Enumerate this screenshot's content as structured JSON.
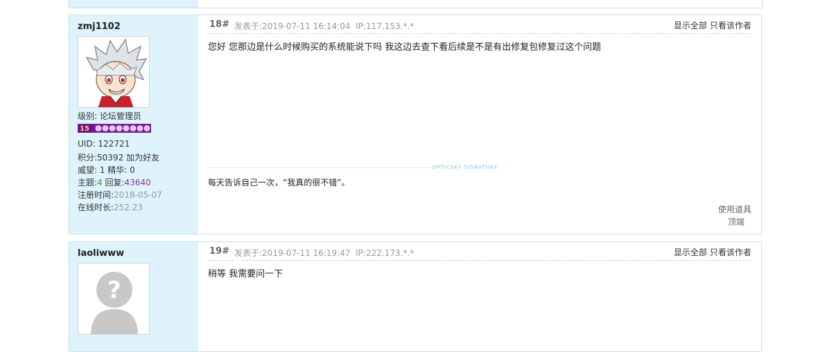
{
  "posts": [
    {
      "username": "zmj1102",
      "level_label": "级别: 论坛管理员",
      "level_badge": "15",
      "uid": "UID: 122721",
      "points_label": "积分:",
      "points": "50392",
      "add_friend": "加为好友",
      "prestige": "威望: 1 精华: 0",
      "topics_label": "主题:",
      "topics": "4",
      "replies_label": " 回复:",
      "replies": "43640",
      "reg_label": "注册时间:",
      "reg_date": "2018-05-07",
      "online_label": "在线时长:",
      "online": "252.23",
      "floor": "18#",
      "posted": "发表于:2019-07-11 16:14:04",
      "ip": "IP:117.153.*.*",
      "show_all": "显示全部",
      "author_only": "只看该作者",
      "content": "您好   您那边是什么时候购买的系统能说下吗  我这边去查下看后续是不是有出修复包修复过这个问题",
      "signature_label": "OPTICSKY SIGNATURE",
      "signature": "每天告诉自己一次，“我真的很不错”。",
      "use_tool": "使用道具",
      "top": "顶端"
    },
    {
      "username": "laoliwww",
      "floor": "19#",
      "posted": "发表于:2019-07-11 16:19:47",
      "ip": "IP:222.173.*.*",
      "show_all": "显示全部",
      "author_only": "只看该作者",
      "content": "稍等 我需要问一下"
    }
  ],
  "colors": {
    "sidebar_bg": "#def3fc",
    "border": "#c9e0ea",
    "badge_purple": "#7a1fa2"
  }
}
